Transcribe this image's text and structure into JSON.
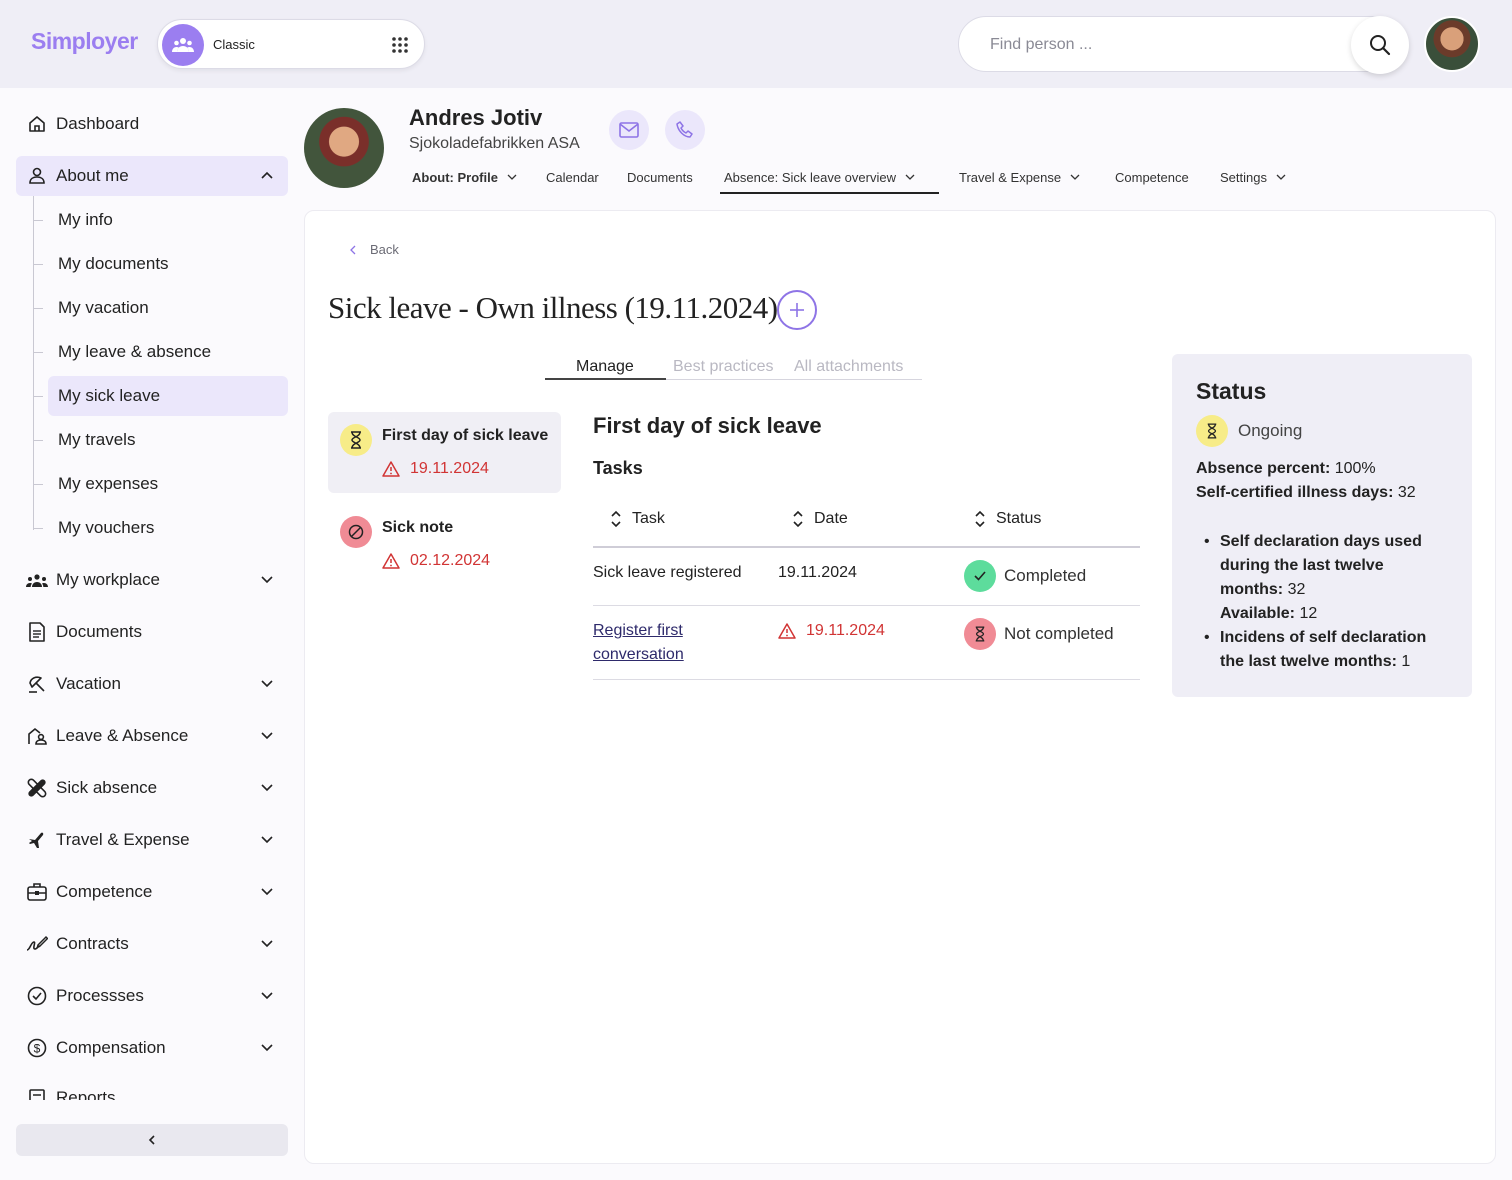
{
  "brand": {
    "logo": "Simployer",
    "accent": "#9b7ef0"
  },
  "switcher": {
    "label": "Classic"
  },
  "search": {
    "placeholder": "Find person ..."
  },
  "sidebar": {
    "dashboard": "Dashboard",
    "about_me": "About me",
    "sub_items": [
      "My info",
      "My documents",
      "My vacation",
      "My leave & absence",
      "My sick leave",
      "My travels",
      "My expenses",
      "My vouchers"
    ],
    "items": [
      "My workplace",
      "Documents",
      "Vacation",
      "Leave & Absence",
      "Sick absence",
      "Travel & Expense",
      "Competence",
      "Contracts",
      "Processses",
      "Compensation",
      "Reports"
    ]
  },
  "profile": {
    "name": "Andres Jotiv",
    "company": "Sjokoladefabrikken ASA"
  },
  "top_tabs": [
    "About: Profile",
    "Calendar",
    "Documents",
    "Absence: Sick leave overview",
    "Travel & Expense",
    "Competence",
    "Settings"
  ],
  "back": "Back",
  "page_title": "Sick leave - Own illness (19.11.2024)",
  "inner_tabs": [
    "Manage",
    "Best practices",
    "All attachments"
  ],
  "steps": [
    {
      "title": "First day of sick leave",
      "date": "19.11.2024",
      "icon": "hourglass-icon"
    },
    {
      "title": "Sick note",
      "date": "02.12.2024",
      "icon": "blocked-icon"
    }
  ],
  "section_title": "First day of sick leave",
  "tasks_heading": "Tasks",
  "table": {
    "headers": [
      "Task",
      "Date",
      "Status"
    ],
    "rows": [
      {
        "task": "Sick leave registered",
        "date": "19.11.2024",
        "status": "Completed"
      },
      {
        "task": "Register first conversation",
        "date": "19.11.2024",
        "status": "Not completed"
      }
    ]
  },
  "status_panel": {
    "title": "Status",
    "state": "Ongoing",
    "absence_label": "Absence percent:",
    "absence_value": "100%",
    "selfcert_label": "Self-certified illness days:",
    "selfcert_value": "32",
    "bullet1_label": "Self declaration days used during the last twelve months:",
    "bullet1_value": "32",
    "available_label": "Available:",
    "available_value": "12",
    "bullet2_label": "Incidens of self declaration the last twelve months:",
    "bullet2_value": "1"
  },
  "colors": {
    "warning_red": "#d13434",
    "success_green": "#5ddc9c",
    "pending_yellow": "#f7ec88",
    "error_pink": "#f08b95"
  }
}
